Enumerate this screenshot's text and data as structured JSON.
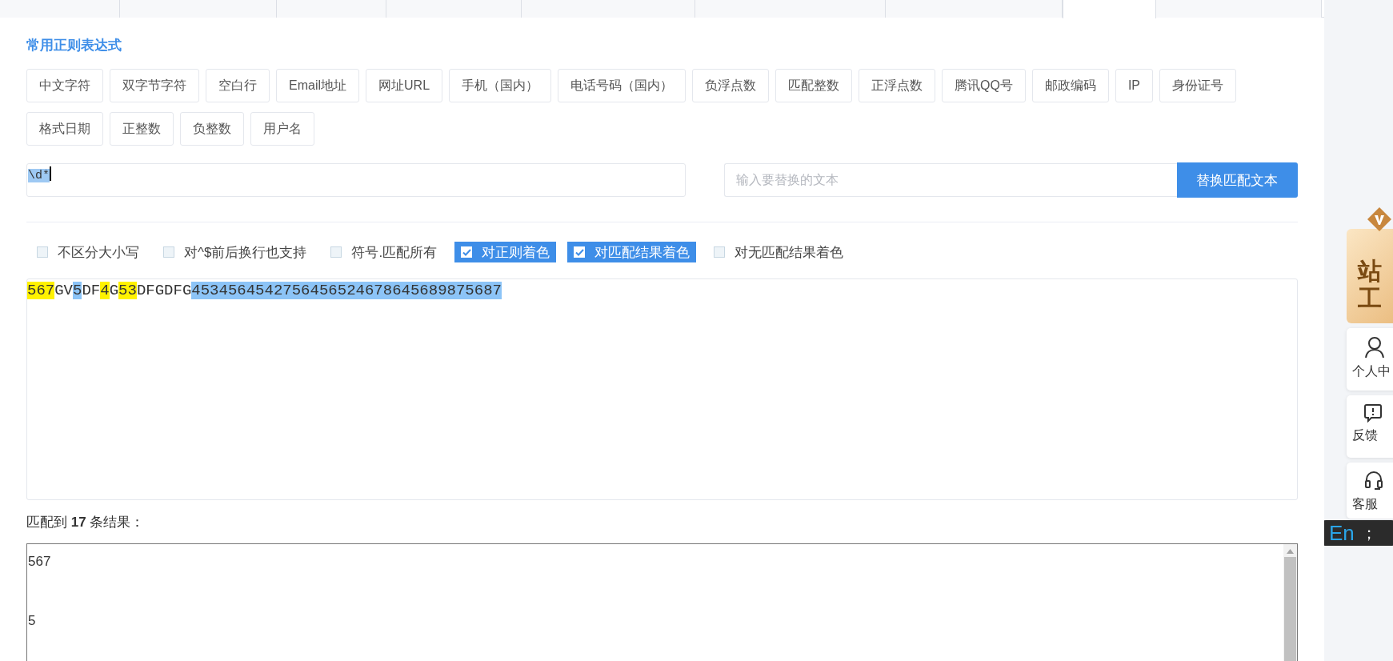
{
  "tabs": [
    {
      "selected": false
    },
    {
      "selected": false
    },
    {
      "selected": false
    },
    {
      "selected": false
    },
    {
      "selected": false
    },
    {
      "selected": false
    },
    {
      "selected": false
    },
    {
      "selected": true
    },
    {
      "selected": false
    }
  ],
  "section_title": "常用正则表达式",
  "presets": [
    "中文字符",
    "双字节字符",
    "空白行",
    "Email地址",
    "网址URL",
    "手机（国内）",
    "电话号码（国内）",
    "负浮点数",
    "匹配整数",
    "正浮点数",
    "腾讯QQ号",
    "邮政编码",
    "IP",
    "身份证号",
    "格式日期",
    "正整数",
    "负整数",
    "用户名"
  ],
  "regex_field": {
    "value": "\\d*",
    "text_selected": true
  },
  "replace_field": {
    "placeholder": "输入要替换的文本"
  },
  "replace_button": "替换匹配文本",
  "options": [
    {
      "label": "不区分大小写",
      "checked": false
    },
    {
      "label": "对^$前后换行也支持",
      "checked": false
    },
    {
      "label": "符号.匹配所有",
      "checked": false
    },
    {
      "label": "对正则着色",
      "checked": true
    },
    {
      "label": "对匹配结果着色",
      "checked": true
    },
    {
      "label": "对无匹配结果着色",
      "checked": false
    }
  ],
  "source_text": [
    {
      "text": "567",
      "color": "#fff200"
    },
    {
      "text": "GV"
    },
    {
      "text": "5",
      "color": "#8cc4f7"
    },
    {
      "text": "DF"
    },
    {
      "text": "4",
      "color": "#fff200"
    },
    {
      "text": "G"
    },
    {
      "text": "53",
      "color": "#fff200"
    },
    {
      "text": "DFGDFG"
    },
    {
      "text": "4534564542756456524678645689875687",
      "color": "#8cc4f7"
    }
  ],
  "match_summary": "匹配到 **17** 条结果：",
  "results": [
    "567",
    "5"
  ],
  "side_rail": {
    "vip_lines": [
      "站",
      "工"
    ],
    "items": [
      {
        "kind": "user",
        "label": "个人中"
      },
      {
        "kind": "feedback",
        "label": "反馈"
      },
      {
        "kind": "support",
        "label": "客服"
      }
    ]
  },
  "ime_indicator": {
    "mode": "En",
    "punct": "；"
  }
}
